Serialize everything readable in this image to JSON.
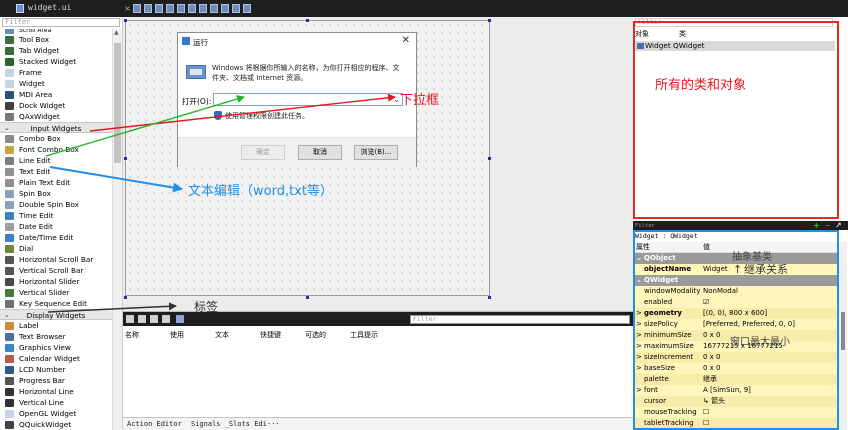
{
  "top_bar": {
    "filename": "widget.ui",
    "tool_icons": [
      "close-icon",
      "edit-widgets-icon",
      "edit-signals-icon",
      "edit-buddies-icon",
      "edit-tab-order-icon",
      "layout-horizontal-icon",
      "layout-vertical-icon",
      "layout-splitter-h-icon",
      "layout-splitter-v-icon",
      "layout-grid-icon",
      "layout-form-icon",
      "break-layout-icon"
    ]
  },
  "widget_box": {
    "filter_placeholder": "Filter",
    "items": [
      {
        "label": "Scroll Area",
        "icon": "scroll-area-icon",
        "color": "#6b8fb8",
        "partial": true
      },
      {
        "label": "Tool Box",
        "icon": "tool-box-icon",
        "color": "#3c6e3c"
      },
      {
        "label": "Tab Widget",
        "icon": "tab-widget-icon",
        "color": "#3a6a3a"
      },
      {
        "label": "Stacked Widget",
        "icon": "stacked-widget-icon",
        "color": "#2f6030"
      },
      {
        "label": "Frame",
        "icon": "frame-icon",
        "color": "#c8d4e6"
      },
      {
        "label": "Widget",
        "icon": "widget-icon",
        "color": "#c8d4e6"
      },
      {
        "label": "MDI Area",
        "icon": "mdi-area-icon",
        "color": "#2e4f7a"
      },
      {
        "label": "Dock Widget",
        "icon": "dock-widget-icon",
        "color": "#404040"
      },
      {
        "label": "QAxWidget",
        "icon": "qaxwidget-icon",
        "color": "#777777"
      },
      {
        "label": "Input Widgets",
        "category": true
      },
      {
        "label": "Combo Box",
        "icon": "combo-box-icon",
        "color": "#8a8a8a"
      },
      {
        "label": "Font Combo Box",
        "icon": "font-combo-box-icon",
        "color": "#c7a33c"
      },
      {
        "label": "Line Edit",
        "icon": "line-edit-icon",
        "color": "#7d7d7d"
      },
      {
        "label": "Text Edit",
        "icon": "text-edit-icon",
        "color": "#909090"
      },
      {
        "label": "Plain Text Edit",
        "icon": "plain-text-edit-icon",
        "color": "#909090"
      },
      {
        "label": "Spin Box",
        "icon": "spin-box-icon",
        "color": "#8aa0c0"
      },
      {
        "label": "Double Spin Box",
        "icon": "double-spin-box-icon",
        "color": "#8aa0c0"
      },
      {
        "label": "Time Edit",
        "icon": "time-edit-icon",
        "color": "#3b7fc4"
      },
      {
        "label": "Date Edit",
        "icon": "date-edit-icon",
        "color": "#a0a0a0"
      },
      {
        "label": "Date/Time Edit",
        "icon": "date-time-edit-icon",
        "color": "#3b7fc4"
      },
      {
        "label": "Dial",
        "icon": "dial-icon",
        "color": "#6a8a3a"
      },
      {
        "label": "Horizontal Scroll Bar",
        "icon": "horizontal-scroll-bar-icon",
        "color": "#555555"
      },
      {
        "label": "Vertical Scroll Bar",
        "icon": "vertical-scroll-bar-icon",
        "color": "#555555"
      },
      {
        "label": "Horizontal Slider",
        "icon": "horizontal-slider-icon",
        "color": "#4a4a4a"
      },
      {
        "label": "Vertical Slider",
        "icon": "vertical-slider-icon",
        "color": "#4a7a3a"
      },
      {
        "label": "Key Sequence Edit",
        "icon": "key-sequence-edit-icon",
        "color": "#707070"
      },
      {
        "label": "Display Widgets",
        "category": true
      },
      {
        "label": "Label",
        "icon": "label-icon",
        "color": "#d08a3a"
      },
      {
        "label": "Text Browser",
        "icon": "text-browser-icon",
        "color": "#4a6fa0"
      },
      {
        "label": "Graphics View",
        "icon": "graphics-view-icon",
        "color": "#3a86c8"
      },
      {
        "label": "Calendar Widget",
        "icon": "calendar-widget-icon",
        "color": "#c0584a"
      },
      {
        "label": "LCD Number",
        "icon": "lcd-number-icon",
        "color": "#2f5a8a"
      },
      {
        "label": "Progress Bar",
        "icon": "progress-bar-icon",
        "color": "#555555"
      },
      {
        "label": "Horizontal Line",
        "icon": "horizontal-line-icon",
        "color": "#333333"
      },
      {
        "label": "Vertical Line",
        "icon": "vertical-line-icon",
        "color": "#333333"
      },
      {
        "label": "OpenGL Widget",
        "icon": "opengl-widget-icon",
        "color": "#c8d4e6"
      },
      {
        "label": "QQuickWidget",
        "icon": "qquickwidget-icon",
        "color": "#444444"
      }
    ]
  },
  "run_dialog": {
    "title": "运行",
    "description": "Windows 将根据你所输入的名称，为你打开相应的程序、文件夹、文档或 Internet 资源。",
    "open_label": "打开(O):",
    "admin_note": "使用管理权限创建此任务。",
    "ok": "确定",
    "cancel": "取消",
    "browse": "浏览(B)..."
  },
  "action_editor": {
    "filter_placeholder": "Filter",
    "headers": [
      "名称",
      "使用",
      "文本",
      "快捷键",
      "可选的",
      "工具提示"
    ],
    "tabs": [
      "Action Editor",
      "Signals _Slots Edi···"
    ]
  },
  "object_inspector": {
    "filter_placeholder": "Filter",
    "col_object": "对象",
    "col_class": "类",
    "row": "Widget  QWidget"
  },
  "property_editor": {
    "filter_placeholder": "Filter",
    "toolbar_add": "+",
    "toolbar_remove": "−",
    "toolbar_config": "↗",
    "class_line": "Widget : QWidget",
    "col_property": "属性",
    "col_value": "值",
    "rows": [
      {
        "kind": "group",
        "name": "QObject"
      },
      {
        "kind": "prop",
        "name": "objectName",
        "value": "Widget",
        "bold": true,
        "bg": "yel",
        "expand": ""
      },
      {
        "kind": "group",
        "name": "QWidget"
      },
      {
        "kind": "prop",
        "name": "windowModality",
        "value": "NonModal",
        "bg": "yel",
        "expand": ""
      },
      {
        "kind": "prop",
        "name": "enabled",
        "value": "☑",
        "bg": "yel",
        "expand": ""
      },
      {
        "kind": "prop",
        "name": "geometry",
        "value": "[(0, 0), 800 x 600]",
        "bold": true,
        "bg": "yel2",
        "expand": ">"
      },
      {
        "kind": "prop",
        "name": "sizePolicy",
        "value": "[Preferred, Preferred, 0, 0]",
        "bg": "yel",
        "expand": ">"
      },
      {
        "kind": "prop",
        "name": "minimumSize",
        "value": "0 x 0",
        "bg": "yel2",
        "expand": ">"
      },
      {
        "kind": "prop",
        "name": "maximumSize",
        "value": "16777215 x 16777215",
        "bg": "yel",
        "expand": ">"
      },
      {
        "kind": "prop",
        "name": "sizeIncrement",
        "value": "0 x 0",
        "bg": "yel2",
        "expand": ">"
      },
      {
        "kind": "prop",
        "name": "baseSize",
        "value": "0 x 0",
        "bg": "yel",
        "expand": ">"
      },
      {
        "kind": "prop",
        "name": "palette",
        "value": "继承",
        "bg": "yel2",
        "expand": ""
      },
      {
        "kind": "prop",
        "name": "font",
        "value": "A  [SimSun, 9]",
        "bg": "yel",
        "expand": ">"
      },
      {
        "kind": "prop",
        "name": "cursor",
        "value": "↳ 箭头",
        "bg": "yel2",
        "expand": ""
      },
      {
        "kind": "prop",
        "name": "mouseTracking",
        "value": "☐",
        "bg": "yel",
        "expand": ""
      },
      {
        "kind": "prop",
        "name": "tabletTracking",
        "value": "☐",
        "bg": "yel2",
        "expand": ""
      }
    ]
  },
  "annotations": {
    "all_classes": "所有的类和对象",
    "dropdown": "下拉框",
    "text_edit": "文本编辑（word,txt等）",
    "label": "标签",
    "abstract_base": "抽象基类",
    "inheritance": "继承关系",
    "max_window": "窗口最大最小",
    "colors": {
      "red": "#e8141e",
      "blue": "#1e8fea",
      "green": "#21b321",
      "dark": "#333333"
    }
  }
}
